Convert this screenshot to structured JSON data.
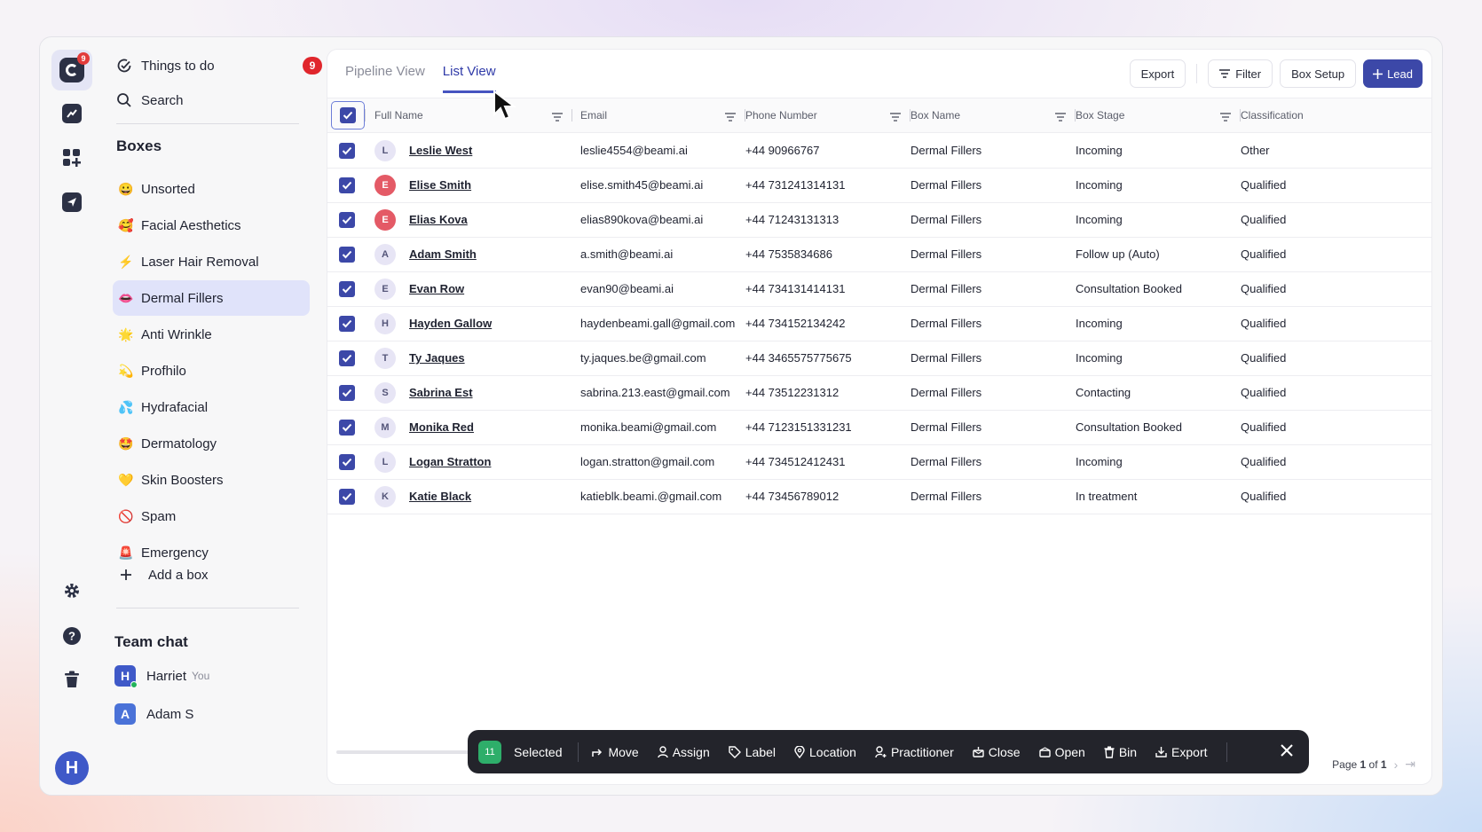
{
  "rail": {
    "logo_badge": "9",
    "avatar_letter": "H"
  },
  "sidebar": {
    "todo_label": "Things to do",
    "todo_count": "9",
    "search_label": "Search",
    "boxes_title": "Boxes",
    "boxes": [
      {
        "emoji": "😀",
        "label": "Unsorted"
      },
      {
        "emoji": "🥰",
        "label": "Facial Aesthetics"
      },
      {
        "emoji": "⚡",
        "label": "Laser Hair Removal"
      },
      {
        "emoji": "👄",
        "label": "Dermal Fillers"
      },
      {
        "emoji": "🌟",
        "label": "Anti Wrinkle"
      },
      {
        "emoji": "💫",
        "label": "Profhilo"
      },
      {
        "emoji": "💦",
        "label": "Hydrafacial"
      },
      {
        "emoji": "🤩",
        "label": "Dermatology"
      },
      {
        "emoji": "💛",
        "label": "Skin Boosters"
      },
      {
        "emoji": "🚫",
        "label": "Spam"
      },
      {
        "emoji": "🚨",
        "label": "Emergency"
      }
    ],
    "add_box_label": "Add a box",
    "team_chat_title": "Team chat",
    "chat": [
      {
        "letter": "H",
        "name": "Harriet",
        "suffix": "You"
      },
      {
        "letter": "A",
        "name": "Adam S",
        "suffix": ""
      }
    ]
  },
  "main": {
    "tabs": [
      "Pipeline View",
      "List View"
    ],
    "export_label": "Export",
    "filter_label": "Filter",
    "box_setup_label": "Box Setup",
    "lead_label": "Lead",
    "columns": [
      "Full Name",
      "Email",
      "Phone Number",
      "Box Name",
      "Box Stage",
      "Classification"
    ],
    "rows": [
      {
        "initial": "L",
        "name": "Leslie West",
        "email": "leslie4554@beami.ai",
        "phone": "+44 90966767",
        "box": "Dermal Fillers",
        "stage": "Incoming",
        "class": "Other",
        "avatar": "purple"
      },
      {
        "initial": "E",
        "name": "Elise Smith",
        "email": "elise.smith45@beami.ai",
        "phone": "+44 731241314131",
        "box": "Dermal Fillers",
        "stage": "Incoming",
        "class": "Qualified",
        "avatar": "red"
      },
      {
        "initial": "E",
        "name": "Elias Kova",
        "email": "elias890kova@beami.ai",
        "phone": "+44 71243131313",
        "box": "Dermal Fillers",
        "stage": "Incoming",
        "class": "Qualified",
        "avatar": "red"
      },
      {
        "initial": "A",
        "name": "Adam Smith",
        "email": "a.smith@beami.ai",
        "phone": "+44 7535834686",
        "box": "Dermal Fillers",
        "stage": "Follow up (Auto)",
        "class": "Qualified",
        "avatar": "purple"
      },
      {
        "initial": "E",
        "name": "Evan Row",
        "email": "evan90@beami.ai",
        "phone": "+44 734131414131",
        "box": "Dermal Fillers",
        "stage": "Consultation Booked",
        "class": "Qualified",
        "avatar": "purple"
      },
      {
        "initial": "H",
        "name": "Hayden Gallow",
        "email": "haydenbeami.gall@gmail.com",
        "phone": "+44 734152134242",
        "box": "Dermal Fillers",
        "stage": "Incoming",
        "class": "Qualified",
        "avatar": "purple"
      },
      {
        "initial": "T",
        "name": "Ty Jaques",
        "email": "ty.jaques.be@gmail.com",
        "phone": "+44 3465575775675",
        "box": "Dermal Fillers",
        "stage": "Incoming",
        "class": "Qualified",
        "avatar": "purple"
      },
      {
        "initial": "S",
        "name": "Sabrina Est",
        "email": "sabrina.213.east@gmail.com",
        "phone": "+44 73512231312",
        "box": "Dermal Fillers",
        "stage": "Contacting",
        "class": "Qualified",
        "avatar": "purple"
      },
      {
        "initial": "M",
        "name": "Monika Red",
        "email": "monika.beami@gmail.com",
        "phone": "+44 7123151331231",
        "box": "Dermal Fillers",
        "stage": "Consultation Booked",
        "class": "Qualified",
        "avatar": "purple"
      },
      {
        "initial": "L",
        "name": "Logan Stratton",
        "email": "logan.stratton@gmail.com",
        "phone": "+44 734512412431",
        "box": "Dermal Fillers",
        "stage": "Incoming",
        "class": "Qualified",
        "avatar": "purple"
      },
      {
        "initial": "K",
        "name": "Katie Black",
        "email": "katieblk.beami.@gmail.com",
        "phone": "+44 73456789012",
        "box": "Dermal Fillers",
        "stage": "In treatment",
        "class": "Qualified",
        "avatar": "purple"
      }
    ],
    "pager": {
      "prefix": "Page",
      "current": "1",
      "of": "of",
      "total": "1"
    }
  },
  "bulk": {
    "count": "11",
    "selected_label": "Selected",
    "actions": [
      "Move",
      "Assign",
      "Label",
      "Location",
      "Practitioner",
      "Close",
      "Open",
      "Bin",
      "Export"
    ]
  }
}
